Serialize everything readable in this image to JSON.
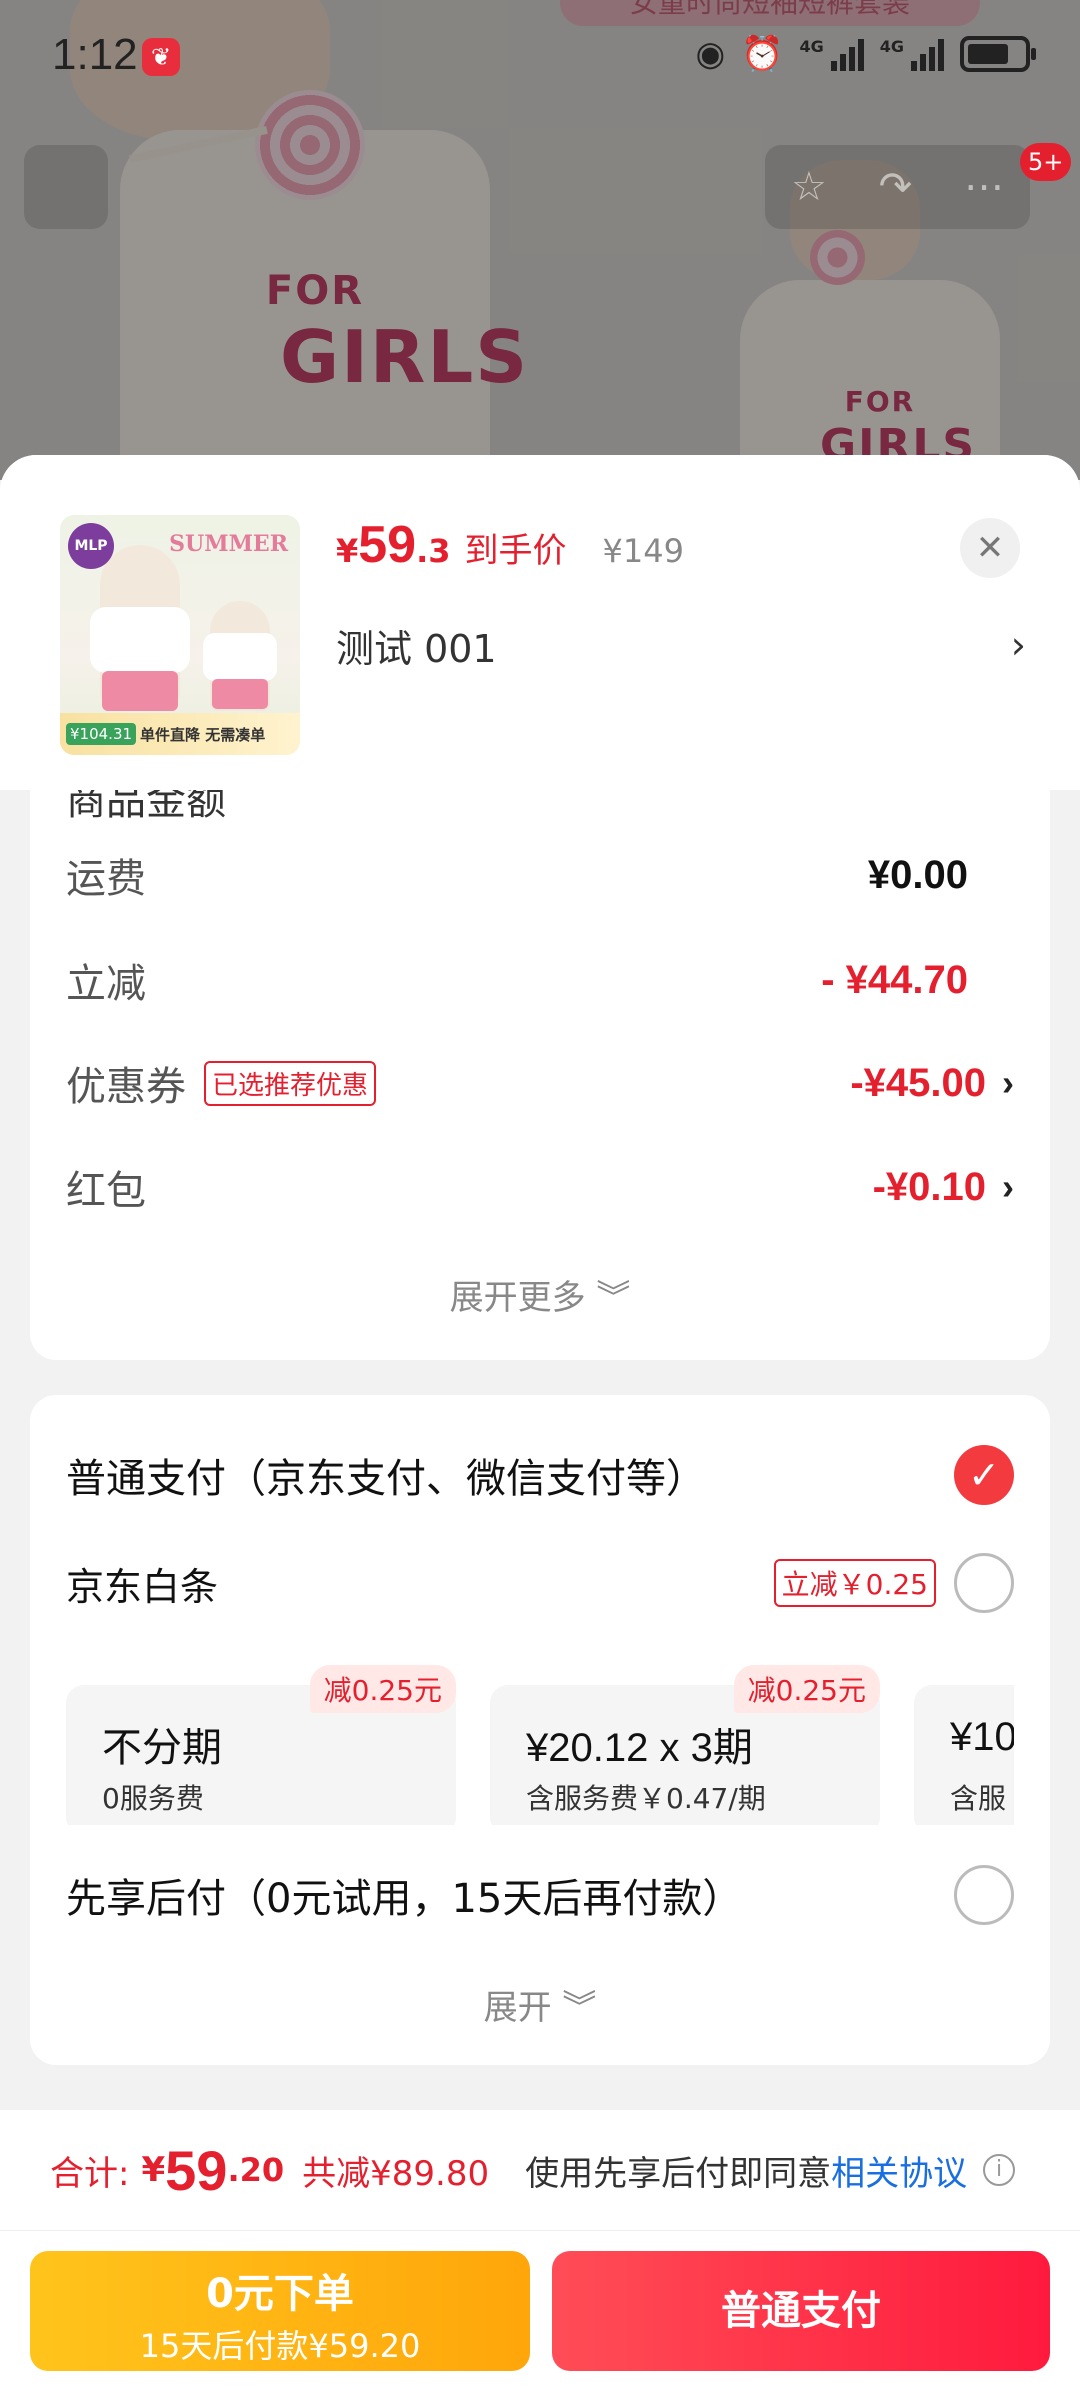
{
  "status_bar": {
    "time": "1:12",
    "app_icon": "jd-app-icon",
    "signal_1": "4G",
    "signal_2": "4G"
  },
  "background": {
    "banner": "女童时尚短袖短裤套装",
    "shirt_text_top": "FOR",
    "shirt_text_bottom": "GIRLS",
    "cart_badge": "5+"
  },
  "product": {
    "price_symbol": "¥",
    "price_int": "59",
    "price_dec": ".3",
    "price_tag": "到手价",
    "orig_price": "¥149",
    "sku": "测试  001",
    "thumb_summer": "SUMMER",
    "thumb_logo": "MLP",
    "thumb_promo_price": "¥104.31",
    "thumb_promo_text": "单件直降 无需凑单"
  },
  "fees": {
    "partial_label": "商品金额",
    "shipping_label": "运费",
    "shipping_value": "¥0.00",
    "discount_label": "立减",
    "discount_value": "- ¥44.70",
    "coupon_label": "优惠券",
    "coupon_tag": "已选推荐优惠",
    "coupon_value": "-¥45.00",
    "redpack_label": "红包",
    "redpack_value": "-¥0.10",
    "expand_more": "展开更多 ︾"
  },
  "payment": {
    "normal_label": "普通支付（京东支付、微信支付等）",
    "baitiao_label": "京东白条",
    "baitiao_tag": "立减￥0.25",
    "plans": [
      {
        "badge": "减0.25元",
        "title": "不分期",
        "sub": "0服务费"
      },
      {
        "badge": "减0.25元",
        "title": "¥20.12 x 3期",
        "sub": "含服务费￥0.47/期"
      },
      {
        "badge": "",
        "title": "¥10",
        "sub": "含服"
      }
    ],
    "later_label": "先享后付（0元试用，15天后再付款）",
    "expand": "展开 ︾"
  },
  "total": {
    "label": "合计:",
    "symbol": "¥",
    "int": "59",
    "dec": ".20",
    "saved": "共减¥89.80",
    "agree_text": "使用先享后付即同意",
    "agree_link": "相关协议"
  },
  "buttons": {
    "zero_line1": "0元下单",
    "zero_line2": "15天后付款¥59.20",
    "normal_pay": "普通支付"
  }
}
